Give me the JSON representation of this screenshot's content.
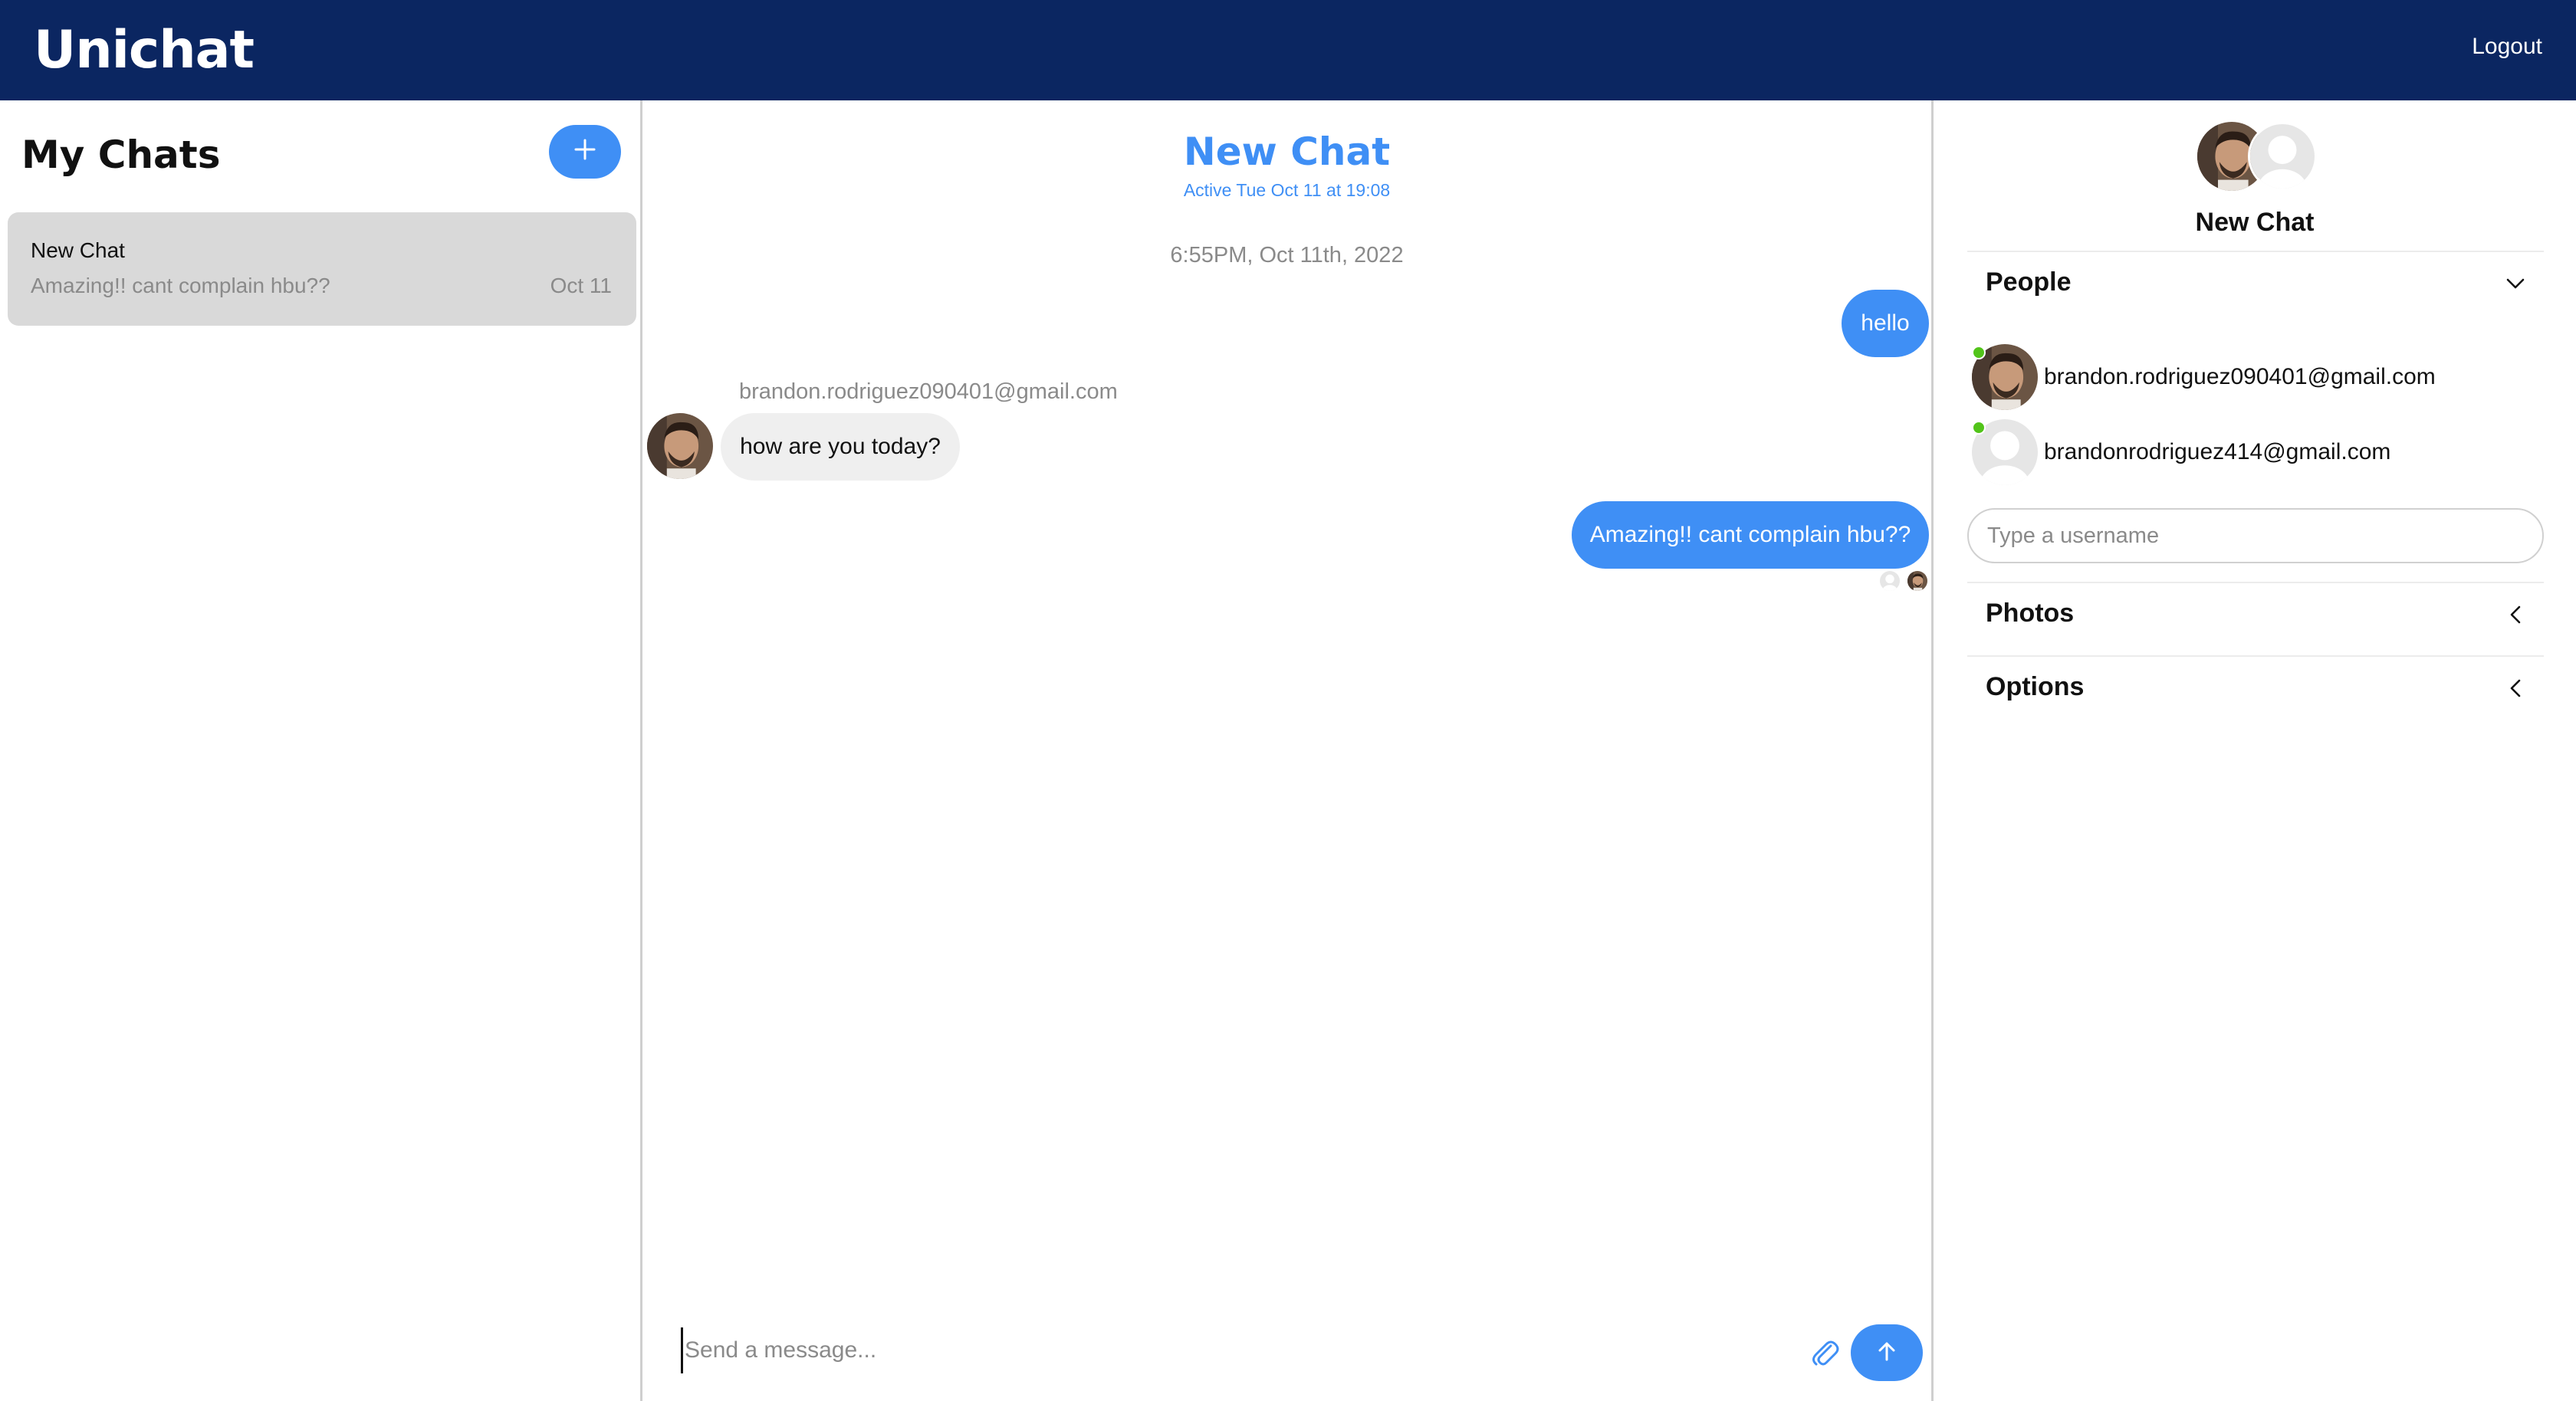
{
  "header": {
    "brand": "Unichat",
    "logout_label": "Logout"
  },
  "sidebar": {
    "title": "My Chats",
    "new_chat_icon": "plus-icon",
    "chats": [
      {
        "title": "New Chat",
        "preview": "Amazing!! cant complain hbu??",
        "date": "Oct 11"
      }
    ]
  },
  "chat": {
    "title": "New Chat",
    "active_status": "Active Tue Oct 11 at 19:08",
    "timestamp": "6:55PM, Oct 11th, 2022",
    "messages": [
      {
        "direction": "outgoing",
        "text": "hello"
      },
      {
        "direction": "incoming",
        "sender": "brandon.rodriguez090401@gmail.com",
        "text": "how are you today?"
      },
      {
        "direction": "outgoing",
        "text": "Amazing!! cant complain hbu??"
      }
    ],
    "composer": {
      "placeholder": "Send a message...",
      "attach_icon": "paperclip-icon",
      "send_icon": "arrow-up-icon"
    }
  },
  "details": {
    "title": "New Chat",
    "sections": {
      "people": "People",
      "photos": "Photos",
      "options": "Options"
    },
    "people": [
      {
        "email": "brandon.rodriguez090401@gmail.com",
        "online": true
      },
      {
        "email": "brandonrodriguez414@gmail.com",
        "online": true
      }
    ],
    "username_placeholder": "Type a username"
  },
  "colors": {
    "header_bg": "#0b2661",
    "accent": "#3f8ff5",
    "online": "#52c41a"
  }
}
